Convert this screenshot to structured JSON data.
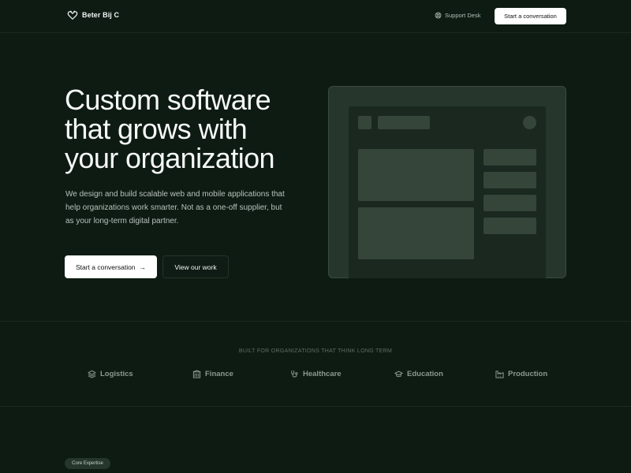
{
  "header": {
    "brand": "Beter Bij C",
    "support_label": "Support Desk",
    "cta_label": "Start a conversation"
  },
  "hero": {
    "title_lines": [
      "Custom software",
      "that grows with",
      "your organization"
    ],
    "subtitle": "We design and build scalable web and mobile applications that help organizations work smarter. Not as a one-off supplier, but as your long-term digital partner.",
    "primary_label": "Start a conversation",
    "primary_arrow": "→",
    "secondary_label": "View our work"
  },
  "industries": {
    "heading": "BUILT FOR ORGANIZATIONS THAT THINK LONG TERM",
    "items": [
      {
        "label": "Logistics",
        "icon": "layers-icon"
      },
      {
        "label": "Finance",
        "icon": "building-icon"
      },
      {
        "label": "Healthcare",
        "icon": "stethoscope-icon"
      },
      {
        "label": "Education",
        "icon": "graduation-cap-icon"
      },
      {
        "label": "Production",
        "icon": "factory-icon"
      }
    ]
  },
  "expertise": {
    "badge": "Core Expertise"
  },
  "colors": {
    "background": "#0d1b13",
    "mockup_frame": "#26362c",
    "mockup_block": "#354539",
    "button_primary": "#ffffff"
  }
}
